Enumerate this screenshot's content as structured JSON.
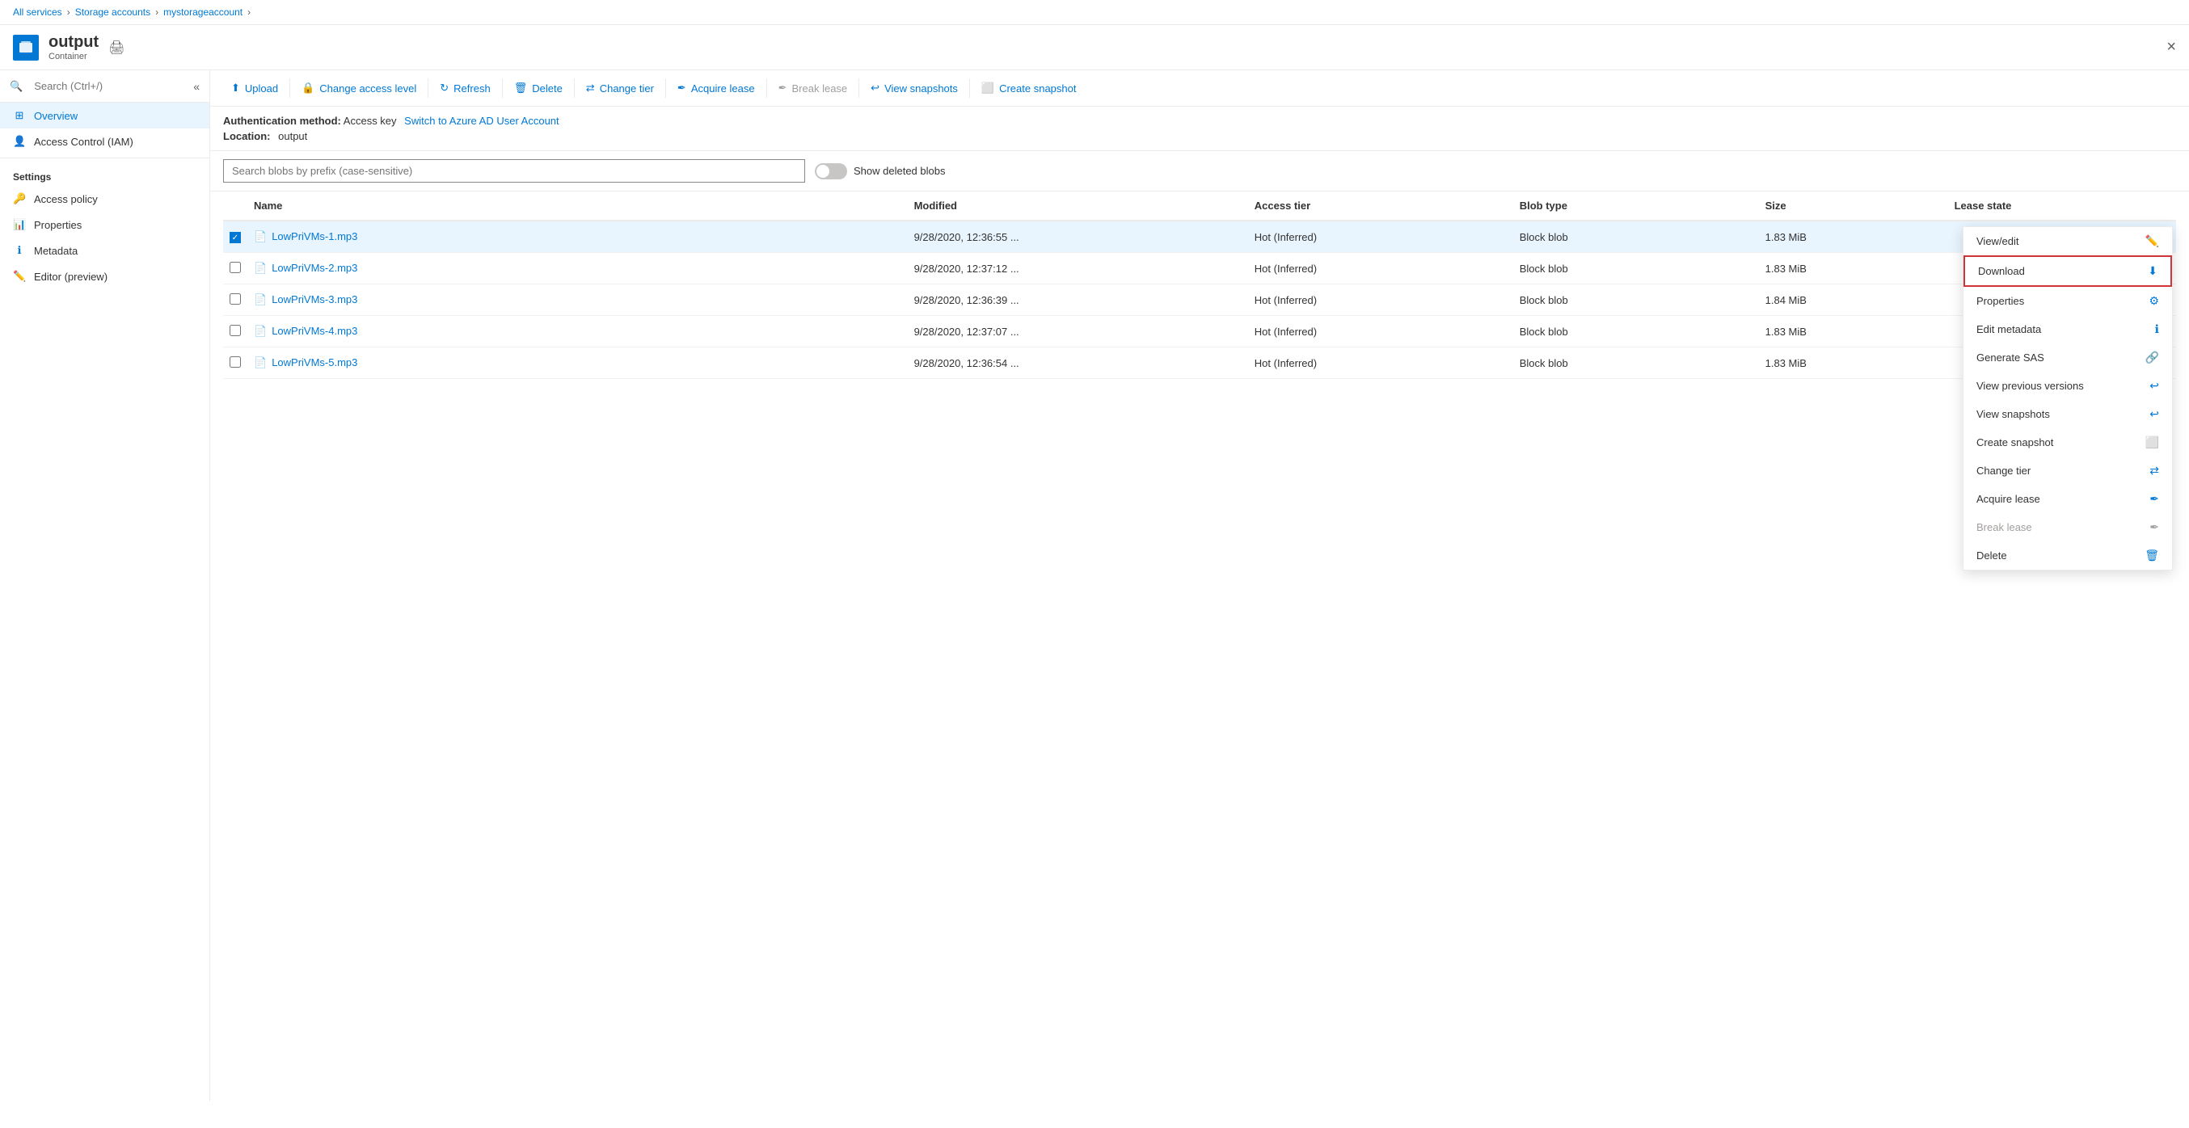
{
  "breadcrumb": {
    "all_services": "All services",
    "storage_accounts": "Storage accounts",
    "account_name": "mystorageaccount"
  },
  "header": {
    "icon_text": "□",
    "title": "output",
    "subtitle": "Container",
    "close_label": "×"
  },
  "sidebar": {
    "search_placeholder": "Search (Ctrl+/)",
    "nav_items": [
      {
        "id": "overview",
        "label": "Overview",
        "active": true
      },
      {
        "id": "iam",
        "label": "Access Control (IAM)",
        "active": false
      }
    ],
    "settings_label": "Settings",
    "settings_items": [
      {
        "id": "access-policy",
        "label": "Access policy"
      },
      {
        "id": "properties",
        "label": "Properties"
      },
      {
        "id": "metadata",
        "label": "Metadata"
      },
      {
        "id": "editor",
        "label": "Editor (preview)"
      }
    ]
  },
  "toolbar": {
    "upload": "Upload",
    "change_access": "Change access level",
    "refresh": "Refresh",
    "delete": "Delete",
    "change_tier": "Change tier",
    "acquire_lease": "Acquire lease",
    "break_lease": "Break lease",
    "view_snapshots": "View snapshots",
    "create_snapshot": "Create snapshot"
  },
  "info_bar": {
    "auth_label": "Authentication method:",
    "auth_value": "Access key",
    "switch_link": "Switch to Azure AD User Account",
    "location_label": "Location:",
    "location_value": "output"
  },
  "search": {
    "placeholder": "Search blobs by prefix (case-sensitive)",
    "show_deleted_label": "Show deleted blobs"
  },
  "table": {
    "columns": [
      "Name",
      "Modified",
      "Access tier",
      "Blob type",
      "Size",
      "Lease state"
    ],
    "rows": [
      {
        "name": "LowPriVMs-1.mp3",
        "modified": "9/28/2020, 12:36:55 ...",
        "access_tier": "Hot (Inferred)",
        "blob_type": "Block blob",
        "size": "1.83 MiB",
        "lease_state": "",
        "selected": true
      },
      {
        "name": "LowPriVMs-2.mp3",
        "modified": "9/28/2020, 12:37:12 ...",
        "access_tier": "Hot (Inferred)",
        "blob_type": "Block blob",
        "size": "1.83 MiB",
        "lease_state": "",
        "selected": false
      },
      {
        "name": "LowPriVMs-3.mp3",
        "modified": "9/28/2020, 12:36:39 ...",
        "access_tier": "Hot (Inferred)",
        "blob_type": "Block blob",
        "size": "1.84 MiB",
        "lease_state": "",
        "selected": false
      },
      {
        "name": "LowPriVMs-4.mp3",
        "modified": "9/28/2020, 12:37:07 ...",
        "access_tier": "Hot (Inferred)",
        "blob_type": "Block blob",
        "size": "1.83 MiB",
        "lease_state": "",
        "selected": false
      },
      {
        "name": "LowPriVMs-5.mp3",
        "modified": "9/28/2020, 12:36:54 ...",
        "access_tier": "Hot (Inferred)",
        "blob_type": "Block blob",
        "size": "1.83 MiB",
        "lease_state": "",
        "selected": false
      }
    ]
  },
  "context_menu": {
    "items": [
      {
        "label": "View/edit",
        "icon": "✏️",
        "disabled": false,
        "highlighted": false
      },
      {
        "label": "Download",
        "icon": "⬇",
        "disabled": false,
        "highlighted": true
      },
      {
        "label": "Properties",
        "icon": "⚙",
        "disabled": false,
        "highlighted": false
      },
      {
        "label": "Edit metadata",
        "icon": "ℹ",
        "disabled": false,
        "highlighted": false
      },
      {
        "label": "Generate SAS",
        "icon": "🔗",
        "disabled": false,
        "highlighted": false
      },
      {
        "label": "View previous versions",
        "icon": "↩",
        "disabled": false,
        "highlighted": false
      },
      {
        "label": "View snapshots",
        "icon": "↩",
        "disabled": false,
        "highlighted": false
      },
      {
        "label": "Create snapshot",
        "icon": "⬜",
        "disabled": false,
        "highlighted": false
      },
      {
        "label": "Change tier",
        "icon": "⇄",
        "disabled": false,
        "highlighted": false
      },
      {
        "label": "Acquire lease",
        "icon": "✒",
        "disabled": false,
        "highlighted": false
      },
      {
        "label": "Break lease",
        "icon": "✒",
        "disabled": true,
        "highlighted": false
      },
      {
        "label": "Delete",
        "icon": "🗑",
        "disabled": false,
        "highlighted": false
      }
    ]
  }
}
